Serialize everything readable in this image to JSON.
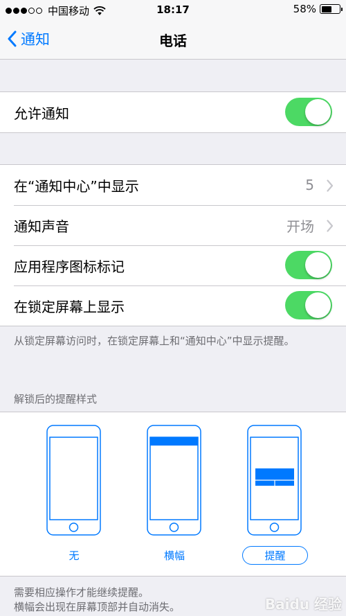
{
  "status_bar": {
    "signal_full": 3,
    "signal_empty": 2,
    "carrier": "中国移动",
    "wifi_icon": "wifi-icon",
    "time": "18:17",
    "battery_text": "58%",
    "battery_level": 0.58
  },
  "nav": {
    "back_label": "通知",
    "title": "电话"
  },
  "allow": {
    "label": "允许通知",
    "on": true
  },
  "settings": {
    "notification_center": {
      "label": "在“通知中心”中显示",
      "value": "5"
    },
    "sound": {
      "label": "通知声音",
      "value": "开场"
    },
    "badge": {
      "label": "应用程序图标标记",
      "on": true
    },
    "lock_screen": {
      "label": "在锁定屏幕上显示",
      "on": true
    }
  },
  "lock_footnote": "从锁定屏幕访问时，在锁定屏幕上和“通知中心”中显示提醒。",
  "alert_style": {
    "header": "解锁后的提醒样式",
    "options": [
      {
        "label": "无",
        "selected": false
      },
      {
        "label": "横幅",
        "selected": false
      },
      {
        "label": "提醒",
        "selected": true
      }
    ]
  },
  "style_footnote": {
    "line1": "需要相应操作才能继续提醒。",
    "line2": "横幅会出现在屏幕顶部并自动消失。"
  },
  "watermark": "Baidu 经验",
  "colors": {
    "accent": "#0079ff",
    "toggle_on": "#4cd964",
    "background": "#efeff4"
  }
}
